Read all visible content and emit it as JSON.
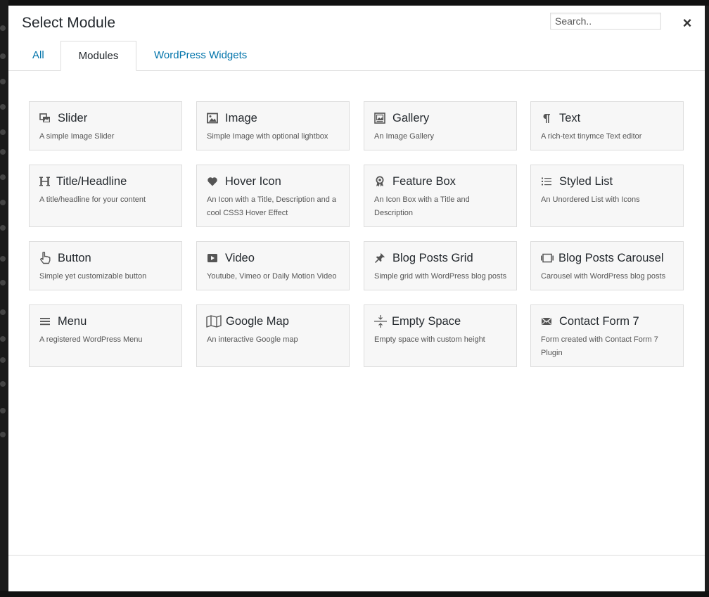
{
  "modal": {
    "title": "Select Module",
    "search_placeholder": "Search..",
    "close_glyph": "×"
  },
  "tabs": [
    {
      "label": "All",
      "active": false
    },
    {
      "label": "Modules",
      "active": true
    },
    {
      "label": "WordPress Widgets",
      "active": false
    }
  ],
  "modules": [
    {
      "title": "Slider",
      "desc": "A simple Image Slider",
      "icon": "slider-icon"
    },
    {
      "title": "Image",
      "desc": "Simple Image with optional lightbox",
      "icon": "image-icon"
    },
    {
      "title": "Gallery",
      "desc": "An Image Gallery",
      "icon": "gallery-icon"
    },
    {
      "title": "Text",
      "desc": "A rich-text tinymce Text editor",
      "icon": "paragraph-icon"
    },
    {
      "title": "Title/Headline",
      "desc": "A title/headline for your content",
      "icon": "heading-icon"
    },
    {
      "title": "Hover Icon",
      "desc": "An Icon with a Title, Description and a cool CSS3 Hover Effect",
      "icon": "heart-icon"
    },
    {
      "title": "Feature Box",
      "desc": "An Icon Box with a Title and Description",
      "icon": "award-icon"
    },
    {
      "title": "Styled List",
      "desc": "An Unordered List with Icons",
      "icon": "list-icon"
    },
    {
      "title": "Button",
      "desc": "Simple yet customizable button",
      "icon": "pointer-hand-icon"
    },
    {
      "title": "Video",
      "desc": "Youtube, Vimeo or Daily Motion Video",
      "icon": "video-play-icon"
    },
    {
      "title": "Blog Posts Grid",
      "desc": "Simple grid with WordPress blog posts",
      "icon": "pin-icon"
    },
    {
      "title": "Blog Posts Carousel",
      "desc": "Carousel with WordPress blog posts",
      "icon": "carousel-icon"
    },
    {
      "title": "Menu",
      "desc": "A registered WordPress Menu",
      "icon": "menu-icon"
    },
    {
      "title": "Google Map",
      "desc": "An interactive Google map",
      "icon": "map-icon"
    },
    {
      "title": "Empty Space",
      "desc": "Empty space with custom height",
      "icon": "vertical-space-icon"
    },
    {
      "title": "Contact Form 7",
      "desc": "Form created with Contact Form 7 Plugin",
      "icon": "envelope-icon"
    }
  ],
  "colors": {
    "link": "#0073aa",
    "card_bg": "#f7f7f7",
    "border": "#dddddd",
    "text": "#23282d"
  }
}
